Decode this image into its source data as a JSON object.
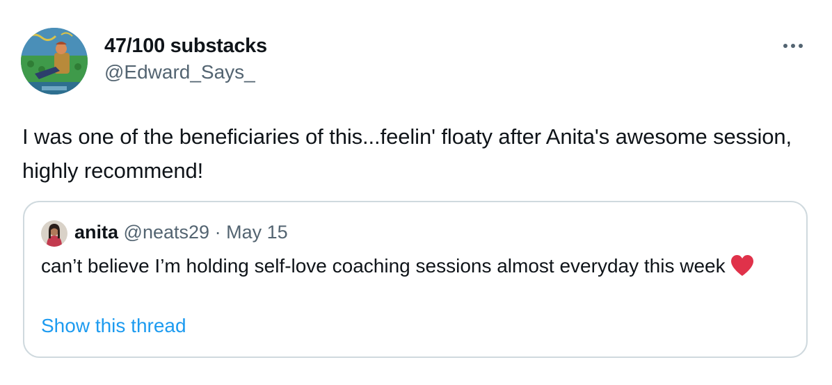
{
  "author": {
    "display_name": "47/100 substacks",
    "handle": "@Edward_Says_"
  },
  "tweet": {
    "text": "I was one of the beneficiaries of this...feelin' floaty after Anita's awesome session, highly recommend!"
  },
  "quoted_tweet": {
    "name": "anita",
    "handle": "@neats29",
    "separator": "·",
    "date": "May 15",
    "text": "can’t believe I’m holding self-love coaching sessions almost everyday this week",
    "emoji": "heart",
    "show_thread_label": "Show this thread"
  },
  "icons": {
    "more": "more-horizontal-icon",
    "heart": "red-heart-emoji"
  },
  "colors": {
    "text_primary": "#0f1419",
    "text_secondary": "#536471",
    "link": "#1d9bf0",
    "border": "#cfd9de",
    "heart": "#e0324a"
  }
}
